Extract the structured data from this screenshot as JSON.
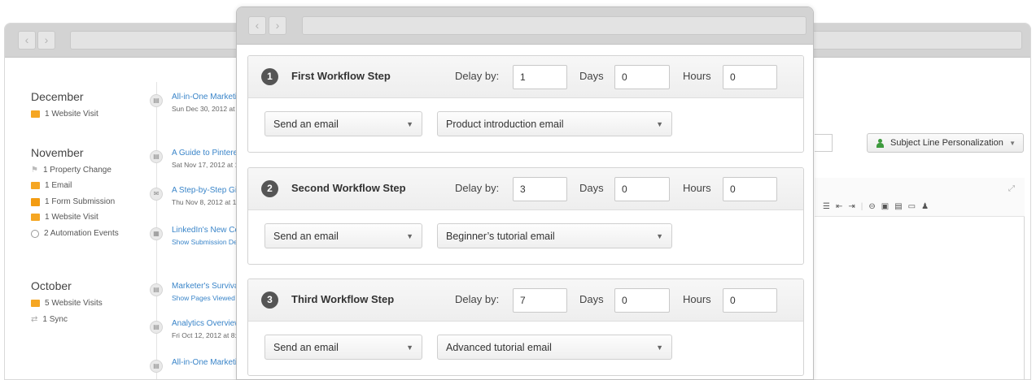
{
  "back_window": {
    "months": [
      {
        "label": "December",
        "events": [
          {
            "icon": "website-visit-icon",
            "text": "1 Website Visit"
          }
        ]
      },
      {
        "label": "November",
        "events": [
          {
            "icon": "property-change-icon",
            "text": "1 Property Change"
          },
          {
            "icon": "email-icon",
            "text": "1 Email"
          },
          {
            "icon": "form-submission-icon",
            "text": "1 Form Submission"
          },
          {
            "icon": "website-visit-icon",
            "text": "1 Website Visit"
          },
          {
            "icon": "automation-clock-icon",
            "text": "2 Automation Events"
          }
        ]
      },
      {
        "label": "October",
        "events": [
          {
            "icon": "website-visit-icon",
            "text": "5 Website Visits"
          },
          {
            "icon": "sync-icon",
            "text": "1 Sync"
          }
        ]
      }
    ],
    "timeline": [
      {
        "title": "All-in-One Marketi",
        "sub": "Sun Dec 30, 2012 at 1"
      },
      {
        "title": "A Guide to Pintere",
        "sub": "Sat Nov 17, 2012 at 1"
      },
      {
        "title": "A Step-by-Step Gi",
        "sub": "Thu Nov 8, 2012 at 11"
      },
      {
        "title": "LinkedIn's New Co",
        "sub": "Show Submission Det"
      },
      {
        "title": "Marketer's Surviva",
        "sub": "Show Pages Viewed -"
      },
      {
        "title": "Analytics Overview",
        "sub": "Fri Oct 12, 2012 at 8:0"
      },
      {
        "title": "All-in-One Marketi",
        "sub": ""
      }
    ],
    "subject_personalization_label": "Subject Line Personalization"
  },
  "workflow": {
    "delay_label": "Delay by:",
    "days_label": "Days",
    "hours_label": "Hours",
    "steps": [
      {
        "number": "1",
        "title": "First Workflow Step",
        "days": "1",
        "hours": "0",
        "minutes": "0",
        "action": "Send an email",
        "email": "Product introduction email"
      },
      {
        "number": "2",
        "title": "Second Workflow Step",
        "days": "3",
        "hours": "0",
        "minutes": "0",
        "action": "Send an email",
        "email": "Beginner’s tutorial email"
      },
      {
        "number": "3",
        "title": "Third Workflow Step",
        "days": "7",
        "hours": "0",
        "minutes": "0",
        "action": "Send an email",
        "email": "Advanced tutorial email"
      }
    ]
  },
  "colors": {
    "link": "#3a85c9",
    "step_badge": "#555555",
    "chrome": "#d3d3d3",
    "personalization_icon": "#3d9a3d"
  }
}
